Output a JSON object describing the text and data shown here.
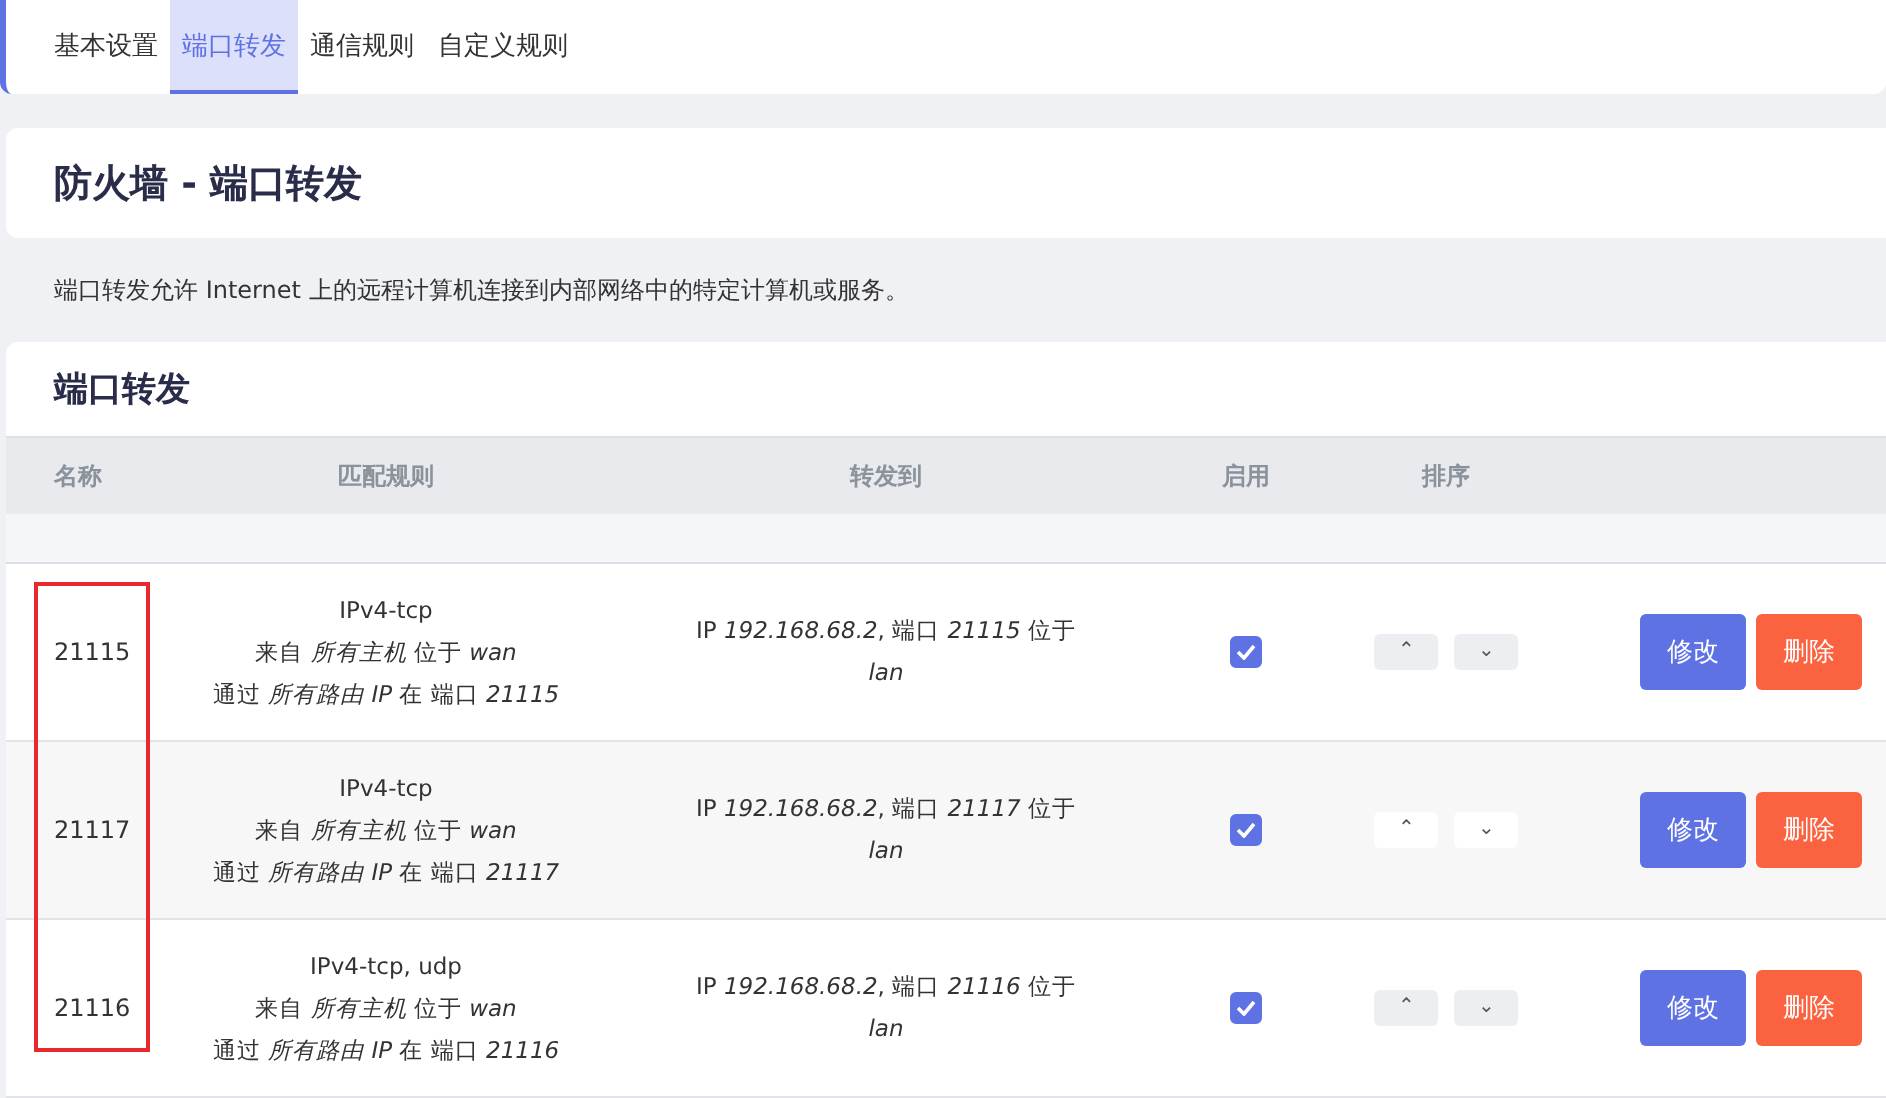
{
  "tabs": [
    {
      "label": "基本设置",
      "selected": false
    },
    {
      "label": "端口转发",
      "selected": true
    },
    {
      "label": "通信规则",
      "selected": false
    },
    {
      "label": "自定义规则",
      "selected": false
    }
  ],
  "page_title": "防火墙 - 端口转发",
  "description": "端口转发允许 Internet 上的远程计算机连接到内部网络中的特定计算机或服务。",
  "section": {
    "title": "端口转发",
    "columns": [
      "名称",
      "匹配规则",
      "转发到",
      "启用",
      "排序"
    ],
    "name_column_highlighted": true,
    "rows": [
      {
        "name": "21115",
        "match": [
          "IPv4-tcp",
          "来自 *所有主机* 位于 *wan*",
          "通过 *所有路由 IP* 在 端口 *21115*"
        ],
        "forward": [
          "IP *192.168.68.2*, 端口 *21115* 位于",
          "*lan*"
        ],
        "enabled": true,
        "up": "⌃",
        "down": "⌄",
        "edit": "修改",
        "delete": "删除"
      },
      {
        "name": "21117",
        "match": [
          "IPv4-tcp",
          "来自 *所有主机* 位于 *wan*",
          "通过 *所有路由 IP* 在 端口 *21117*"
        ],
        "forward": [
          "IP *192.168.68.2*, 端口 *21117* 位于",
          "*lan*"
        ],
        "enabled": true,
        "up": "⌃",
        "down": "⌄",
        "edit": "修改",
        "delete": "删除"
      },
      {
        "name": "21116",
        "match": [
          "IPv4-tcp, udp",
          "来自 *所有主机* 位于 *wan*",
          "通过 *所有路由 IP* 在 端口 *21116*"
        ],
        "forward": [
          "IP *192.168.68.2*, 端口 *21116* 位于",
          "*lan*"
        ],
        "enabled": true,
        "up": "⌃",
        "down": "⌄",
        "edit": "修改",
        "delete": "删除"
      }
    ]
  }
}
